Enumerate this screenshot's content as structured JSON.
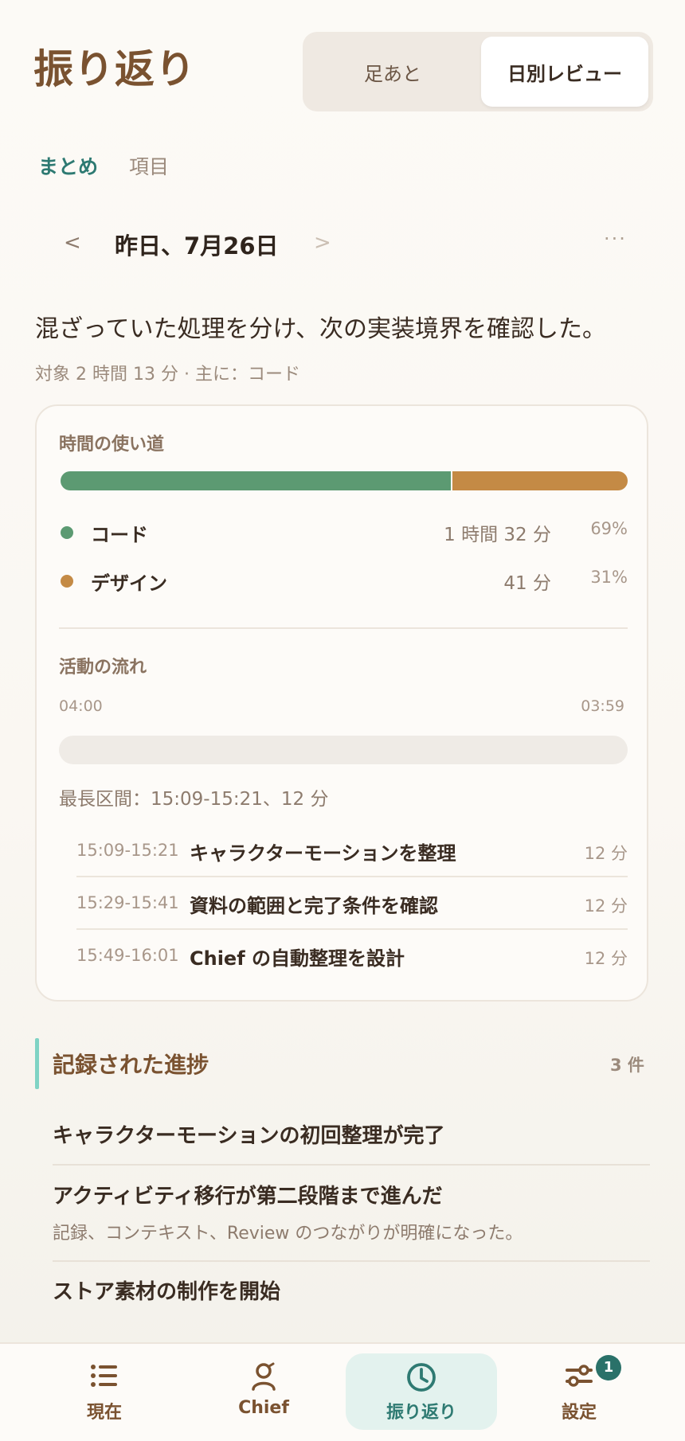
{
  "header": {
    "title": "振り返り",
    "segments": [
      "足あと",
      "日別レビュー"
    ],
    "active_segment": "日別レビュー"
  },
  "subtabs": [
    "まとめ",
    "項目"
  ],
  "date_nav": {
    "prev": "<",
    "label": "昨日、7月26日",
    "next": ">",
    "more": "···"
  },
  "summary": {
    "headline": "混ざっていた処理を分け、次の実装境界を確認した。",
    "meta": "対象 2 時間 13 分 · 主に：コード"
  },
  "time_usage": {
    "title": "時間の使い道",
    "categories": [
      {
        "label": "コード",
        "time": "1 時間 32 分",
        "percent": "69%",
        "fraction": 0.69,
        "color": "#5c9a72"
      },
      {
        "label": "デザイン",
        "time": "41 分",
        "percent": "31%",
        "fraction": 0.31,
        "color": "#c48a45"
      }
    ]
  },
  "activity_flow": {
    "title": "活動の流れ",
    "start": "04:00",
    "end": "03:59",
    "longest": "最長区間：15:09-15:21、12 分",
    "sessions": [
      {
        "time": "15:09-15:21",
        "title": "キャラクターモーションを整理",
        "duration": "12 分"
      },
      {
        "time": "15:29-15:41",
        "title": "資料の範囲と完了条件を確認",
        "duration": "12 分"
      },
      {
        "time": "15:49-16:01",
        "title": "Chief の自動整理を設計",
        "duration": "12 分"
      }
    ]
  },
  "progress": {
    "title": "記録された進捗",
    "count": "3 件",
    "items": [
      {
        "title": "キャラクターモーションの初回整理が完了",
        "desc": ""
      },
      {
        "title": "アクティビティ移行が第二段階まで進んだ",
        "desc": "記録、コンテキスト、Review のつながりが明確になった。"
      },
      {
        "title": "ストア素材の制作を開始",
        "desc": ""
      }
    ]
  },
  "bottom_nav": {
    "items": [
      {
        "label": "現在",
        "icon": "list-icon"
      },
      {
        "label": "Chief",
        "icon": "person-icon"
      },
      {
        "label": "振り返り",
        "icon": "clock-icon"
      },
      {
        "label": "設定",
        "icon": "sliders-icon",
        "badge": "1"
      }
    ],
    "active": "振り返り"
  }
}
